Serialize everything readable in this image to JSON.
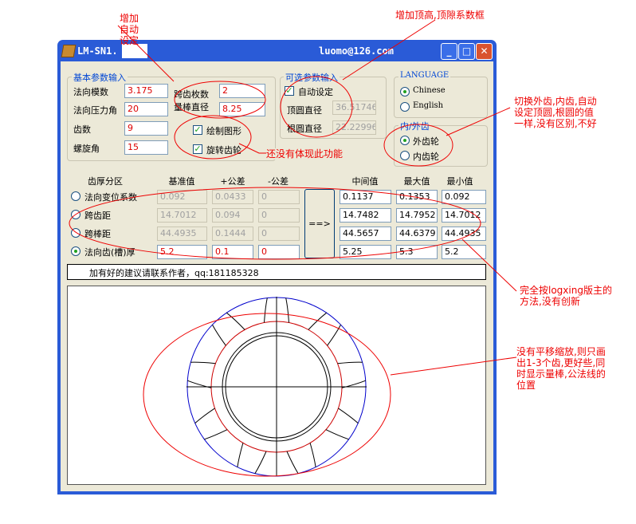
{
  "window": {
    "title": "LM-SN1.",
    "email": "luomo@126.com",
    "minimize": "_",
    "maximize": "□",
    "close": "✕"
  },
  "basic": {
    "group_label": "基本参数输入",
    "normal_module_label": "法向模数",
    "normal_module": "3.175",
    "pressure_angle_label": "法向压力角",
    "pressure_angle": "20",
    "teeth_label": "齿数",
    "teeth": "9",
    "helix_label": "螺旋角",
    "helix": "15",
    "span_teeth_label": "跨齿枚数",
    "span_teeth": "2",
    "pin_dia_label": "量棒直径",
    "pin_dia": "8.25",
    "draw_label": "绘制图形",
    "rotate_label": "旋转齿轮"
  },
  "optional": {
    "group_label": "可选参数输入",
    "auto_label": "自动设定",
    "tip_dia_label": "顶圆直径",
    "tip_dia": "36.51746",
    "root_dia_label": "根圆直径",
    "root_dia": "22.22996"
  },
  "language": {
    "group_label": "LANGUAGE",
    "chinese": "Chinese",
    "english": "English"
  },
  "gear_type": {
    "group_label": "内/外齿",
    "external": "外齿轮",
    "internal": "内齿轮"
  },
  "table": {
    "headers": [
      "齿厚分区",
      "基准值",
      "+公差",
      "-公差",
      "中间值",
      "最大值",
      "最小值"
    ],
    "arrow_label": "==>",
    "rows": [
      {
        "label": "法向变位系数",
        "base": "0.092",
        "plus": "0.0433",
        "minus": "0",
        "mid": "0.1137",
        "max": "0.1353",
        "min": "0.092"
      },
      {
        "label": "跨齿距",
        "base": "14.7012",
        "plus": "0.094",
        "minus": "0",
        "mid": "14.7482",
        "max": "14.7952",
        "min": "14.7012"
      },
      {
        "label": "跨棒距",
        "base": "44.4935",
        "plus": "0.1444",
        "minus": "0",
        "mid": "44.5657",
        "max": "44.6379",
        "min": "44.4935"
      },
      {
        "label": "法向齿(槽)厚",
        "base": "5.2",
        "plus": "0.1",
        "minus": "0",
        "mid": "5.25",
        "max": "5.3",
        "min": "5.2"
      }
    ]
  },
  "status": "加有好的建议请联系作者，qq:181185328",
  "annotations": {
    "auto_set": "增加\n自动\n设定",
    "tip_clearance": "增加顶高,顶隙系数框",
    "switch_gear": "切换外齿,内齿,自动\n设定顶圆,根圆的值\n一样,没有区别,不好",
    "no_function": "还没有体现此功能",
    "copy_method": "完全按logxing版主的\n方法,没有创新",
    "no_zoom": "没有平移缩放,则只画\n出1-3个齿,更好些,同\n时显示量棒,公法线的\n位置"
  },
  "colors": {
    "title_bar": "#2a5bd7",
    "annotation": "#e00000",
    "gear_blue": "#0000cc",
    "gear_red": "#cc0000"
  }
}
